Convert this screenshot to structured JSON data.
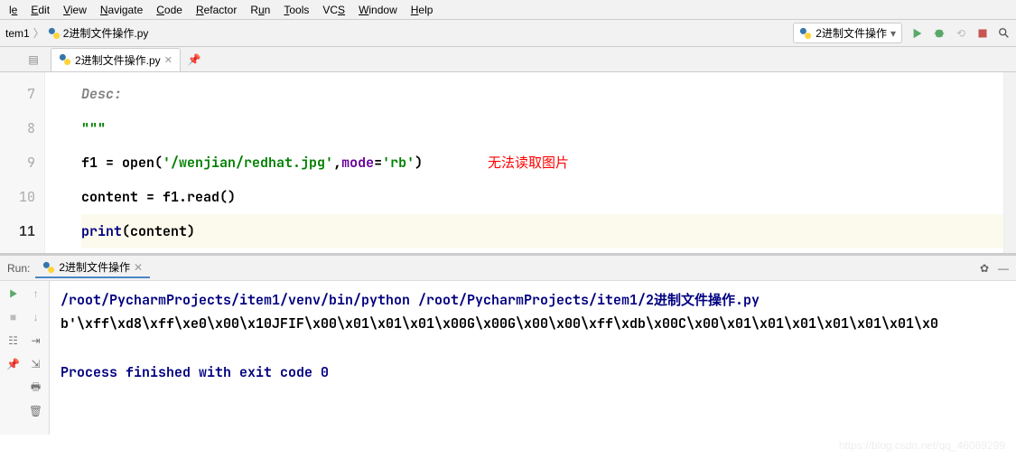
{
  "menu": {
    "items": [
      "le",
      "Edit",
      "View",
      "Navigate",
      "Code",
      "Refactor",
      "Run",
      "Tools",
      "VCS",
      "Window",
      "Help"
    ]
  },
  "breadcrumb": {
    "proj": "tem1",
    "file": "2进制文件操作.py"
  },
  "runconfig": {
    "label": "2进制文件操作"
  },
  "tab": {
    "label": "2进制文件操作.py"
  },
  "code": {
    "lines": [
      {
        "n": "7",
        "html": "<span class='comment'>Desc:</span>"
      },
      {
        "n": "8",
        "html": "<span class='str'>\"\"\"</span>"
      },
      {
        "n": "9",
        "html": "f1 = <span class='fn'>open</span>(<span class='str'>'/wenjian/redhat.jpg'</span>,<span class='param'>mode</span>=<span class='str'>'rb'</span>)"
      },
      {
        "n": "10",
        "html": "content = f1.read()"
      },
      {
        "n": "11",
        "html": "<span class='kw'>print</span>(content)"
      }
    ],
    "current": "11",
    "annotation": "无法读取图片"
  },
  "run": {
    "title": "Run:",
    "tab": "2进制文件操作",
    "cmd": "/root/PycharmProjects/item1/venv/bin/python /root/PycharmProjects/item1/2进制文件操作.py",
    "output": "b'\\xff\\xd8\\xff\\xe0\\x00\\x10JFIF\\x00\\x01\\x01\\x01\\x00G\\x00G\\x00\\x00\\xff\\xdb\\x00C\\x00\\x01\\x01\\x01\\x01\\x01\\x01\\x0",
    "exit": "Process finished with exit code 0"
  },
  "watermark": "https://blog.csdn.net/qq_46089299"
}
